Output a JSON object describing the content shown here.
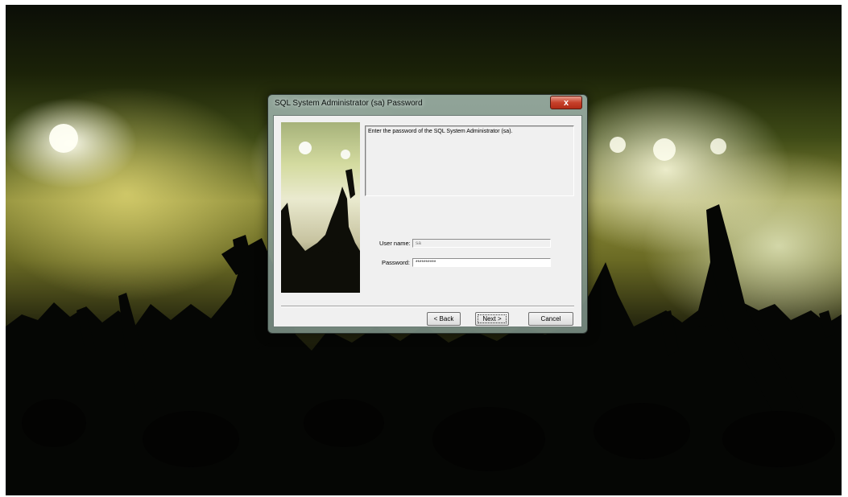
{
  "dialog": {
    "title": "SQL System Administrator (sa) Password",
    "close_label": "x",
    "description": "Enter the password of the SQL System Administrator (sa).",
    "username_label": "User name:",
    "username_value": "sa",
    "password_label": "Password:",
    "password_value": "**********",
    "buttons": {
      "back": "< Back",
      "next": "Next >",
      "cancel": "Cancel"
    }
  },
  "icons": {
    "close": "close-icon"
  }
}
